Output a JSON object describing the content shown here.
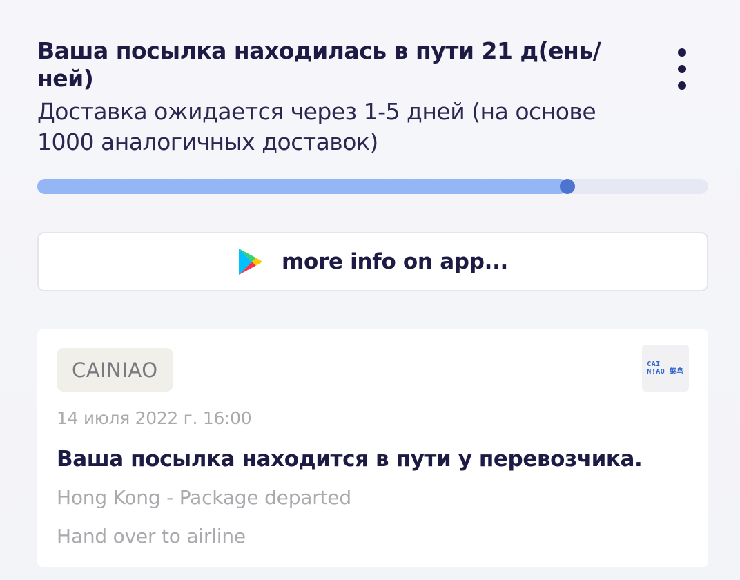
{
  "summary": {
    "title": "Ваша посылка находилась в пути 21 д(ень/ней)",
    "subtitle": "Доставка ожидается через 1-5 дней (на основе 1000 аналогичных доставок)",
    "progress_fraction": 0.79
  },
  "app_button": {
    "label": "more info on app..."
  },
  "event": {
    "carrier": "CAINIAO",
    "logo_text": "CAI\nN!AO 菜鸟",
    "date": "14 июля 2022 г. 16:00",
    "status": "Ваша посылка находится в пути у перевозчика.",
    "details": [
      "Hong Kong - Package departed",
      "Hand over to airline"
    ]
  },
  "colors": {
    "text_dark": "#1d1b44",
    "progress_fill": "#94b6f5",
    "progress_knob": "#4d74cf",
    "progress_track": "#e6e8f3",
    "muted_text": "#a9a9ae",
    "logo_blue": "#2f64c9"
  },
  "icons": {
    "menu": "more-vertical-icon",
    "store": "google-play-icon"
  }
}
